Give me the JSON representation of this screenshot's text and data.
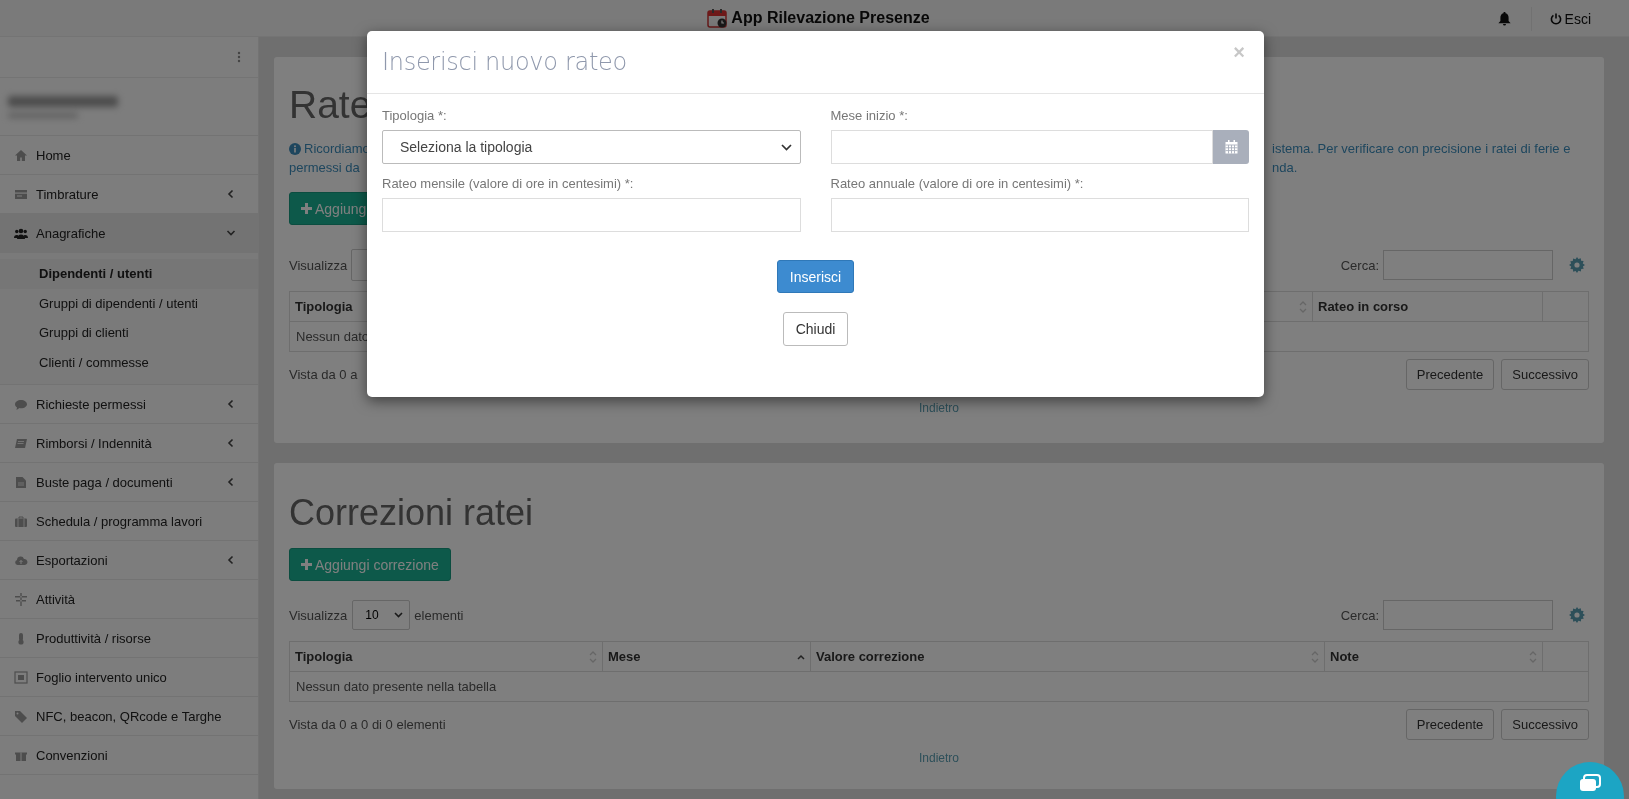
{
  "app_bar": {
    "title": "App Rilevazione Presenze",
    "logout": "Esci"
  },
  "sidebar": {
    "items": [
      {
        "label": "Home",
        "kind": "link"
      },
      {
        "label": "Timbrature",
        "kind": "group",
        "expanded": false
      },
      {
        "label": "Anagrafiche",
        "kind": "group",
        "expanded": true,
        "children": [
          {
            "label": "Dipendenti / utenti",
            "selected": true
          },
          {
            "label": "Gruppi di dipendenti / utenti",
            "selected": false
          },
          {
            "label": "Gruppi di clienti",
            "selected": false
          },
          {
            "label": "Clienti / commesse",
            "selected": false
          }
        ]
      },
      {
        "label": "Richieste permessi",
        "kind": "group",
        "expanded": false
      },
      {
        "label": "Rimborsi / Indennità",
        "kind": "group",
        "expanded": false
      },
      {
        "label": "Buste paga / documenti",
        "kind": "group",
        "expanded": false
      },
      {
        "label": "Schedula / programma lavori",
        "kind": "link"
      },
      {
        "label": "Esportazioni",
        "kind": "group",
        "expanded": false
      },
      {
        "label": "Attività",
        "kind": "link"
      },
      {
        "label": "Produttività / risorse",
        "kind": "link"
      },
      {
        "label": "Foglio intervento unico",
        "kind": "link"
      },
      {
        "label": "NFC, beacon, QRcode e Targhe",
        "kind": "link"
      },
      {
        "label": "Convenzioni",
        "kind": "link"
      }
    ]
  },
  "ratei": {
    "title": "Rate",
    "notice_left": [
      "Ricordiamo",
      "permessi da"
    ],
    "notice_right": [
      "istema. Per verificare con precisione i ratei di ferie e",
      "nda."
    ],
    "add_button": "Aggiung",
    "show_label": "Visualizza",
    "search_label": "Cerca:",
    "columns": [
      {
        "label": "Tipologia"
      },
      {
        "label": "Rateo in corso"
      }
    ],
    "empty_row": "Nessun dato",
    "info": "Vista da 0 a",
    "prev": "Precedente",
    "next": "Successivo",
    "back": "Indietro"
  },
  "correzioni": {
    "title": "Correzioni ratei",
    "add_button": "Aggiungi correzione",
    "show_label": "Visualizza",
    "page_length": "10",
    "show_suffix": "elementi",
    "search_label": "Cerca:",
    "columns": [
      {
        "label": "Tipologia",
        "sorted": false
      },
      {
        "label": "Mese",
        "sorted": true
      },
      {
        "label": "Valore correzione",
        "sorted": false
      },
      {
        "label": "Note",
        "sorted": false
      }
    ],
    "empty_row": "Nessun dato presente nella tabella",
    "info": "Vista da 0 a 0 di 0 elementi",
    "prev": "Precedente",
    "next": "Successivo",
    "back": "Indietro"
  },
  "modal": {
    "title": "Inserisci nuovo rateo",
    "close": "×",
    "fields": [
      {
        "label": "Tipologia *:",
        "kind": "select",
        "value": "Seleziona la tipologia"
      },
      {
        "label": "Mese inizio *:",
        "kind": "date"
      },
      {
        "label": "Rateo mensile (valore di ore in centesimi) *:",
        "kind": "text"
      },
      {
        "label": "Rateo annuale (valore di ore in centesimi) *:",
        "kind": "text"
      }
    ],
    "submit": "Inserisci",
    "dismiss": "Chiudi"
  }
}
